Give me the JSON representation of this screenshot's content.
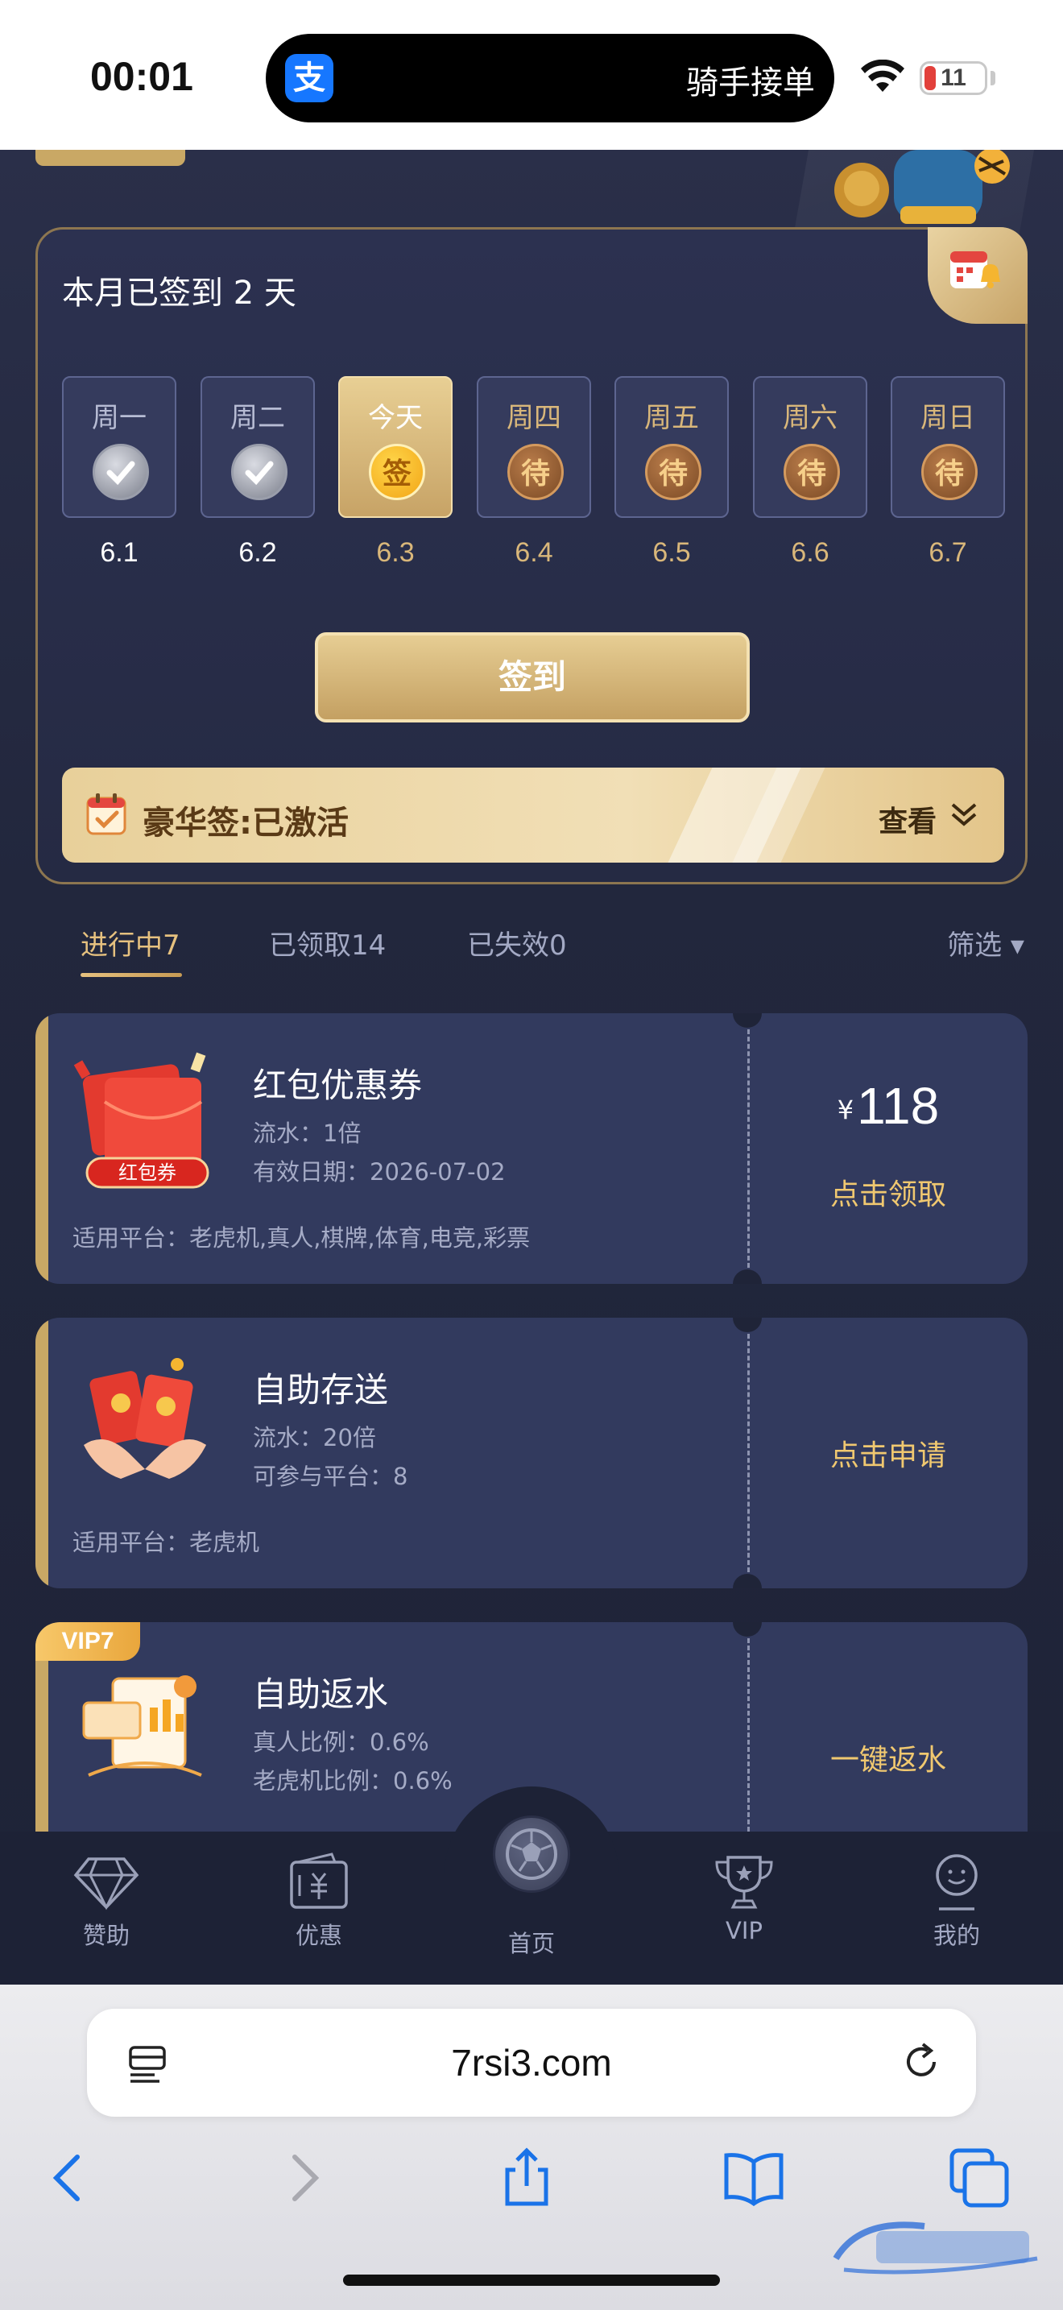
{
  "status": {
    "time": "00:01",
    "island_app": "支",
    "island_text": "骑手接单",
    "battery": "11"
  },
  "signin": {
    "title": "本月已签到 2 天",
    "days": [
      {
        "label": "周一",
        "badge": "",
        "date": "6.1",
        "state": "done"
      },
      {
        "label": "周二",
        "badge": "",
        "date": "6.2",
        "state": "done"
      },
      {
        "label": "今天",
        "badge": "签",
        "date": "6.3",
        "state": "today"
      },
      {
        "label": "周四",
        "badge": "待",
        "date": "6.4",
        "state": "pending"
      },
      {
        "label": "周五",
        "badge": "待",
        "date": "6.5",
        "state": "pending"
      },
      {
        "label": "周六",
        "badge": "待",
        "date": "6.6",
        "state": "pending"
      },
      {
        "label": "周日",
        "badge": "待",
        "date": "6.7",
        "state": "pending"
      }
    ],
    "button": "签到",
    "luxury_text": "豪华签:已激活",
    "luxury_view": "查看"
  },
  "tabs": {
    "active": "进行中7",
    "claimed": "已领取14",
    "expired": "已失效0",
    "filter": "筛选 ▾"
  },
  "coupons": [
    {
      "title": "红包优惠券",
      "line1": "流水：1倍",
      "line2": "有效日期：2026-07-02",
      "platform": "适用平台：老虎机,真人,棋牌,体育,电竞,彩票",
      "currency": "¥",
      "amount": "118",
      "action": "点击领取",
      "img_tag": "红包券"
    },
    {
      "title": "自助存送",
      "line1": "流水：20倍",
      "line2": "可参与平台：8",
      "platform": "适用平台：老虎机",
      "action": "点击申请"
    },
    {
      "title": "自助返水",
      "vip": "VIP7",
      "line1": "真人比例：0.6%",
      "line2": "老虎机比例：0.6%",
      "action": "一键返水"
    }
  ],
  "nav": {
    "sponsor": "赞助",
    "offers": "优惠",
    "home": "首页",
    "vip": "VIP",
    "mine": "我的"
  },
  "browser": {
    "url": "7rsi3.com"
  },
  "colors": {
    "gold": "#c9a865",
    "card": "#323a5e",
    "accent_text": "#f0c870"
  }
}
